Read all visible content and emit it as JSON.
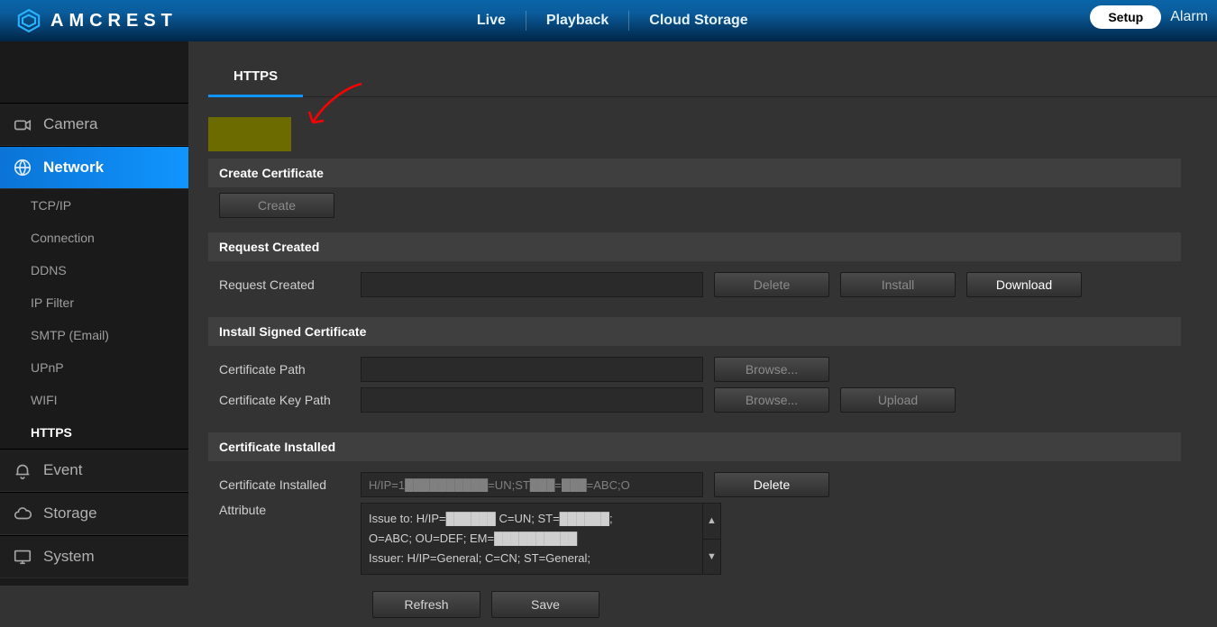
{
  "brand": "AMCREST",
  "topnav": {
    "live": "Live",
    "playback": "Playback",
    "cloud": "Cloud Storage"
  },
  "topright": {
    "setup": "Setup",
    "alarm": "Alarm"
  },
  "sidebar": {
    "camera": "Camera",
    "network": "Network",
    "network_items": {
      "tcpip": "TCP/IP",
      "connection": "Connection",
      "ddns": "DDNS",
      "ipfilter": "IP Filter",
      "smtp": "SMTP (Email)",
      "upnp": "UPnP",
      "wifi": "WIFI",
      "https": "HTTPS"
    },
    "event": "Event",
    "storage": "Storage",
    "system": "System"
  },
  "page": {
    "tab_https": "HTTPS",
    "sec_create": "Create Certificate",
    "btn_create": "Create",
    "sec_request": "Request Created",
    "lbl_request": "Request Created",
    "btn_delete": "Delete",
    "btn_install": "Install",
    "btn_download": "Download",
    "sec_install_signed": "Install Signed Certificate",
    "lbl_cert_path": "Certificate Path",
    "lbl_key_path": "Certificate Key Path",
    "btn_browse": "Browse...",
    "btn_upload": "Upload",
    "sec_cert_installed": "Certificate Installed",
    "lbl_cert_installed": "Certificate Installed",
    "cert_installed_value": "H/IP=1██████████=UN;ST███=███=ABC;O",
    "lbl_attribute": "Attribute",
    "attribute_text": "Issue to: H/IP=██████ C=UN; ST=██████;\nO=ABC; OU=DEF; EM=██████████\nIssuer: H/IP=General; C=CN; ST=General;",
    "btn_refresh": "Refresh",
    "btn_save": "Save"
  }
}
